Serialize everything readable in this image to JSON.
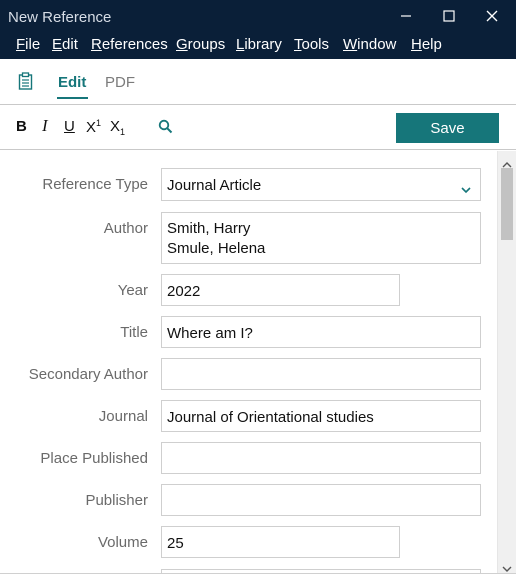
{
  "window": {
    "title": "New Reference",
    "controls": [
      "minimize",
      "maximize",
      "close"
    ]
  },
  "menu": [
    {
      "accel": "F",
      "rest": "ile"
    },
    {
      "accel": "E",
      "rest": "dit"
    },
    {
      "accel": "R",
      "rest": "eferences"
    },
    {
      "accel": "G",
      "rest": "roups"
    },
    {
      "accel": "L",
      "rest": "ibrary"
    },
    {
      "accel": "T",
      "rest": "ools"
    },
    {
      "accel": "W",
      "rest": "indow"
    },
    {
      "accel": "H",
      "rest": "elp"
    }
  ],
  "tabs": {
    "edit": "Edit",
    "pdf": "PDF",
    "active": "Edit"
  },
  "toolbar": {
    "bold": "B",
    "italic": "I",
    "underline": "U",
    "superscript": "X",
    "superscript_mark": "1",
    "subscript": "X",
    "subscript_mark": "1",
    "search_icon": "search-icon",
    "save_label": "Save"
  },
  "form": {
    "reference_type": {
      "label": "Reference Type",
      "value": "Journal Article"
    },
    "author": {
      "label": "Author",
      "values": [
        "Smith, Harry",
        "Smule, Helena"
      ]
    },
    "year": {
      "label": "Year",
      "value": "2022"
    },
    "title": {
      "label": "Title",
      "value": "Where am I?"
    },
    "secondary_author": {
      "label": "Secondary Author",
      "value": ""
    },
    "journal": {
      "label": "Journal",
      "value": "Journal of Orientational studies"
    },
    "place_published": {
      "label": "Place Published",
      "value": ""
    },
    "publisher": {
      "label": "Publisher",
      "value": ""
    },
    "volume": {
      "label": "Volume",
      "value": "25"
    }
  },
  "colors": {
    "titlebar": "#0a1f38",
    "accent": "#16767a",
    "label": "#6a6a6a"
  }
}
